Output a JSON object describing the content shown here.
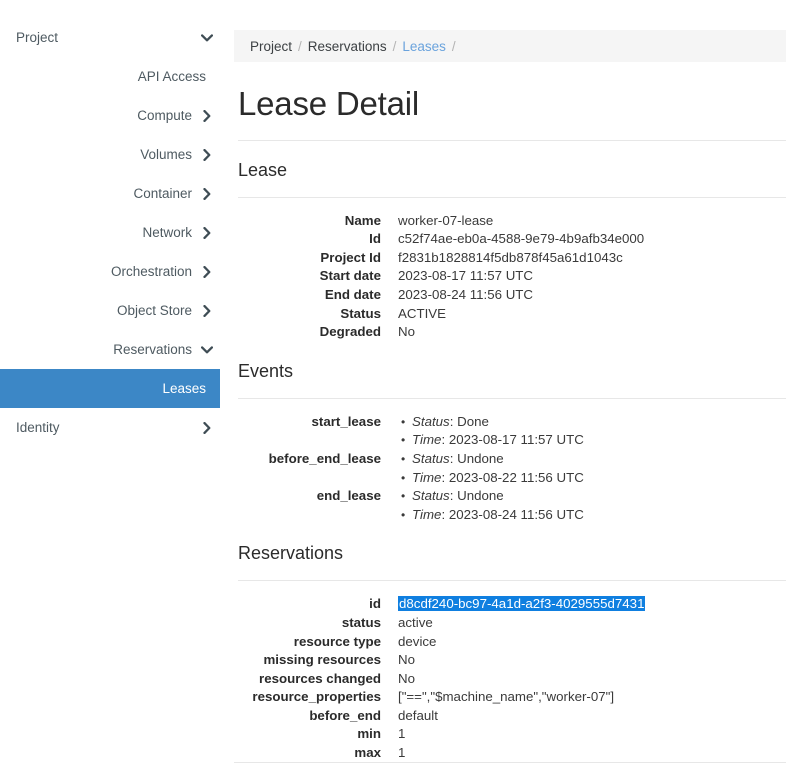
{
  "sidebar": {
    "items": [
      {
        "label": "Project",
        "icon": "chevron-down-icon",
        "align": "left",
        "state": "expanded"
      },
      {
        "label": "API Access",
        "icon": "none",
        "align": "right",
        "state": "child"
      },
      {
        "label": "Compute",
        "icon": "chevron-right-icon",
        "align": "right",
        "state": "collapsed"
      },
      {
        "label": "Volumes",
        "icon": "chevron-right-icon",
        "align": "right",
        "state": "collapsed"
      },
      {
        "label": "Container",
        "icon": "chevron-right-icon",
        "align": "right",
        "state": "collapsed"
      },
      {
        "label": "Network",
        "icon": "chevron-right-icon",
        "align": "right",
        "state": "collapsed"
      },
      {
        "label": "Orchestration",
        "icon": "chevron-right-icon",
        "align": "right",
        "state": "collapsed"
      },
      {
        "label": "Object Store",
        "icon": "chevron-right-icon",
        "align": "right",
        "state": "collapsed"
      },
      {
        "label": "Reservations",
        "icon": "chevron-down-icon",
        "align": "right",
        "state": "expanded"
      },
      {
        "label": "Leases",
        "icon": "none",
        "align": "right",
        "state": "active"
      },
      {
        "label": "Identity",
        "icon": "chevron-right-icon",
        "align": "left",
        "state": "collapsed"
      }
    ],
    "active_bg": "#3c87c6"
  },
  "breadcrumb": {
    "items": [
      {
        "label": "Project",
        "link": false
      },
      {
        "label": "Reservations",
        "link": false
      },
      {
        "label": "Leases",
        "link": true
      }
    ],
    "separator": "/"
  },
  "page": {
    "title": "Lease Detail"
  },
  "lease_section": {
    "title": "Lease",
    "rows": [
      {
        "term": "Name",
        "value": "worker-07-lease"
      },
      {
        "term": "Id",
        "value": "c52f74ae-eb0a-4588-9e79-4b9afb34e000"
      },
      {
        "term": "Project Id",
        "value": "f2831b1828814f5db878f45a61d1043c"
      },
      {
        "term": "Start date",
        "value": "2023-08-17 11:57 UTC"
      },
      {
        "term": "End date",
        "value": "2023-08-24 11:56 UTC"
      },
      {
        "term": "Status",
        "value": "ACTIVE"
      },
      {
        "term": "Degraded",
        "value": "No"
      }
    ]
  },
  "events_section": {
    "title": "Events",
    "rows": [
      {
        "term": "start_lease",
        "bullets": [
          {
            "key": "Status",
            "value": "Done"
          },
          {
            "key": "Time",
            "value": "2023-08-17 11:57 UTC"
          }
        ]
      },
      {
        "term": "before_end_lease",
        "bullets": [
          {
            "key": "Status",
            "value": "Undone"
          },
          {
            "key": "Time",
            "value": "2023-08-22 11:56 UTC"
          }
        ]
      },
      {
        "term": "end_lease",
        "bullets": [
          {
            "key": "Status",
            "value": "Undone"
          },
          {
            "key": "Time",
            "value": "2023-08-24 11:56 UTC"
          }
        ]
      }
    ]
  },
  "reservations_section": {
    "title": "Reservations",
    "selection_color": "#0f7fe0",
    "rows": [
      {
        "term": "id",
        "value": "d8cdf240-bc97-4a1d-a2f3-4029555d7431",
        "selected": true
      },
      {
        "term": "status",
        "value": "active",
        "selected": false
      },
      {
        "term": "resource type",
        "value": "device",
        "selected": false
      },
      {
        "term": "missing resources",
        "value": "No",
        "selected": false
      },
      {
        "term": "resources changed",
        "value": "No",
        "selected": false
      },
      {
        "term": "resource_properties",
        "value": "[\"==\",\"$machine_name\",\"worker-07\"]",
        "selected": false
      },
      {
        "term": "before_end",
        "value": "default",
        "selected": false
      },
      {
        "term": "min",
        "value": "1",
        "selected": false
      },
      {
        "term": "max",
        "value": "1",
        "selected": false
      }
    ]
  }
}
